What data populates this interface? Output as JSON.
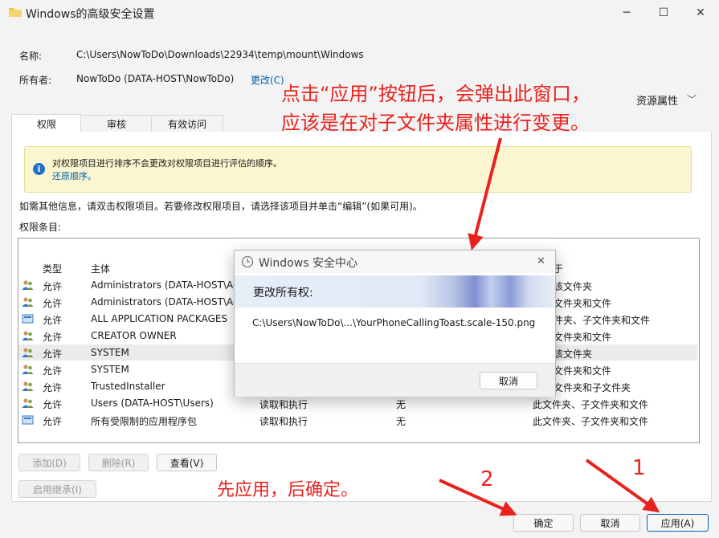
{
  "window": {
    "title": "Windows的高级安全设置",
    "controls": {
      "minimize": "─",
      "maximize": "☐",
      "close": "✕"
    }
  },
  "header": {
    "name_label": "名称:",
    "name_value": "C:\\Users\\NowToDo\\Downloads\\22934\\temp\\mount\\Windows",
    "owner_label": "所有者:",
    "owner_value": "NowToDo (DATA-HOST\\NowToDo)",
    "change_link": "更改(C)",
    "resource_props": "资源属性",
    "resource_chevron": "﹀"
  },
  "tabs": [
    {
      "label": "权限"
    },
    {
      "label": "审核"
    },
    {
      "label": "有效访问"
    }
  ],
  "info": {
    "text": "对权限项目进行排序不会更改对权限项目进行评估的顺序。",
    "link": "还原顺序。"
  },
  "instructions": "如需其他信息，请双击权限项目。若要修改权限项目，请选择该项目并单击“编辑”(如果可用)。",
  "entries_label": "权限条目:",
  "columns": {
    "type": "类型",
    "principal": "主体",
    "applies_tail": "于"
  },
  "rows": [
    {
      "type": "允许",
      "principal": "Administrators (DATA-HOST\\Ad",
      "access": "",
      "inherited": "",
      "applies": "该文件夹"
    },
    {
      "type": "允许",
      "principal": "Administrators (DATA-HOST\\Ad",
      "access": "",
      "inherited": "",
      "applies": "文件夹和文件"
    },
    {
      "type": "允许",
      "principal": "ALL APPLICATION PACKAGES",
      "access": "",
      "inherited": "",
      "applies": "件夹、子文件夹和文件"
    },
    {
      "type": "允许",
      "principal": "CREATOR OWNER",
      "access": "",
      "inherited": "",
      "applies": "文件夹和文件"
    },
    {
      "type": "允许",
      "principal": "SYSTEM",
      "access": "",
      "inherited": "",
      "applies": "该文件夹"
    },
    {
      "type": "允许",
      "principal": "SYSTEM",
      "access": "",
      "inherited": "",
      "applies": "文件夹和文件"
    },
    {
      "type": "允许",
      "principal": "TrustedInstaller",
      "access": "",
      "inherited": "",
      "applies": "文件夹和子文件夹"
    },
    {
      "type": "允许",
      "principal": "Users (DATA-HOST\\Users)",
      "access": "读取和执行",
      "inherited": "无",
      "applies": "此文件夹、子文件夹和文件"
    },
    {
      "type": "允许",
      "principal": "所有受限制的应用程序包",
      "access": "读取和执行",
      "inherited": "无",
      "applies": "此文件夹、子文件夹和文件"
    }
  ],
  "buttons": {
    "add": "添加(D)",
    "remove": "删除(R)",
    "view": "查看(V)",
    "enable_inheritance": "启用继承(I)",
    "ok": "确定",
    "cancel": "取消",
    "apply": "应用(A)"
  },
  "dialog": {
    "title": "Windows 安全中心",
    "heading": "更改所有权:",
    "path": "C:\\Users\\NowToDo\\...\\YourPhoneCallingToast.scale-150.png",
    "cancel": "取消",
    "close": "✕"
  },
  "annotations": {
    "callout_line1": "点击“应用”按钮后，会弹出此窗口，",
    "callout_line2": "应该是在对子文件夹属性进行变更。",
    "bottom_note": "先应用，后确定。",
    "num1": "1",
    "num2": "2",
    "color": "#e8231f"
  }
}
